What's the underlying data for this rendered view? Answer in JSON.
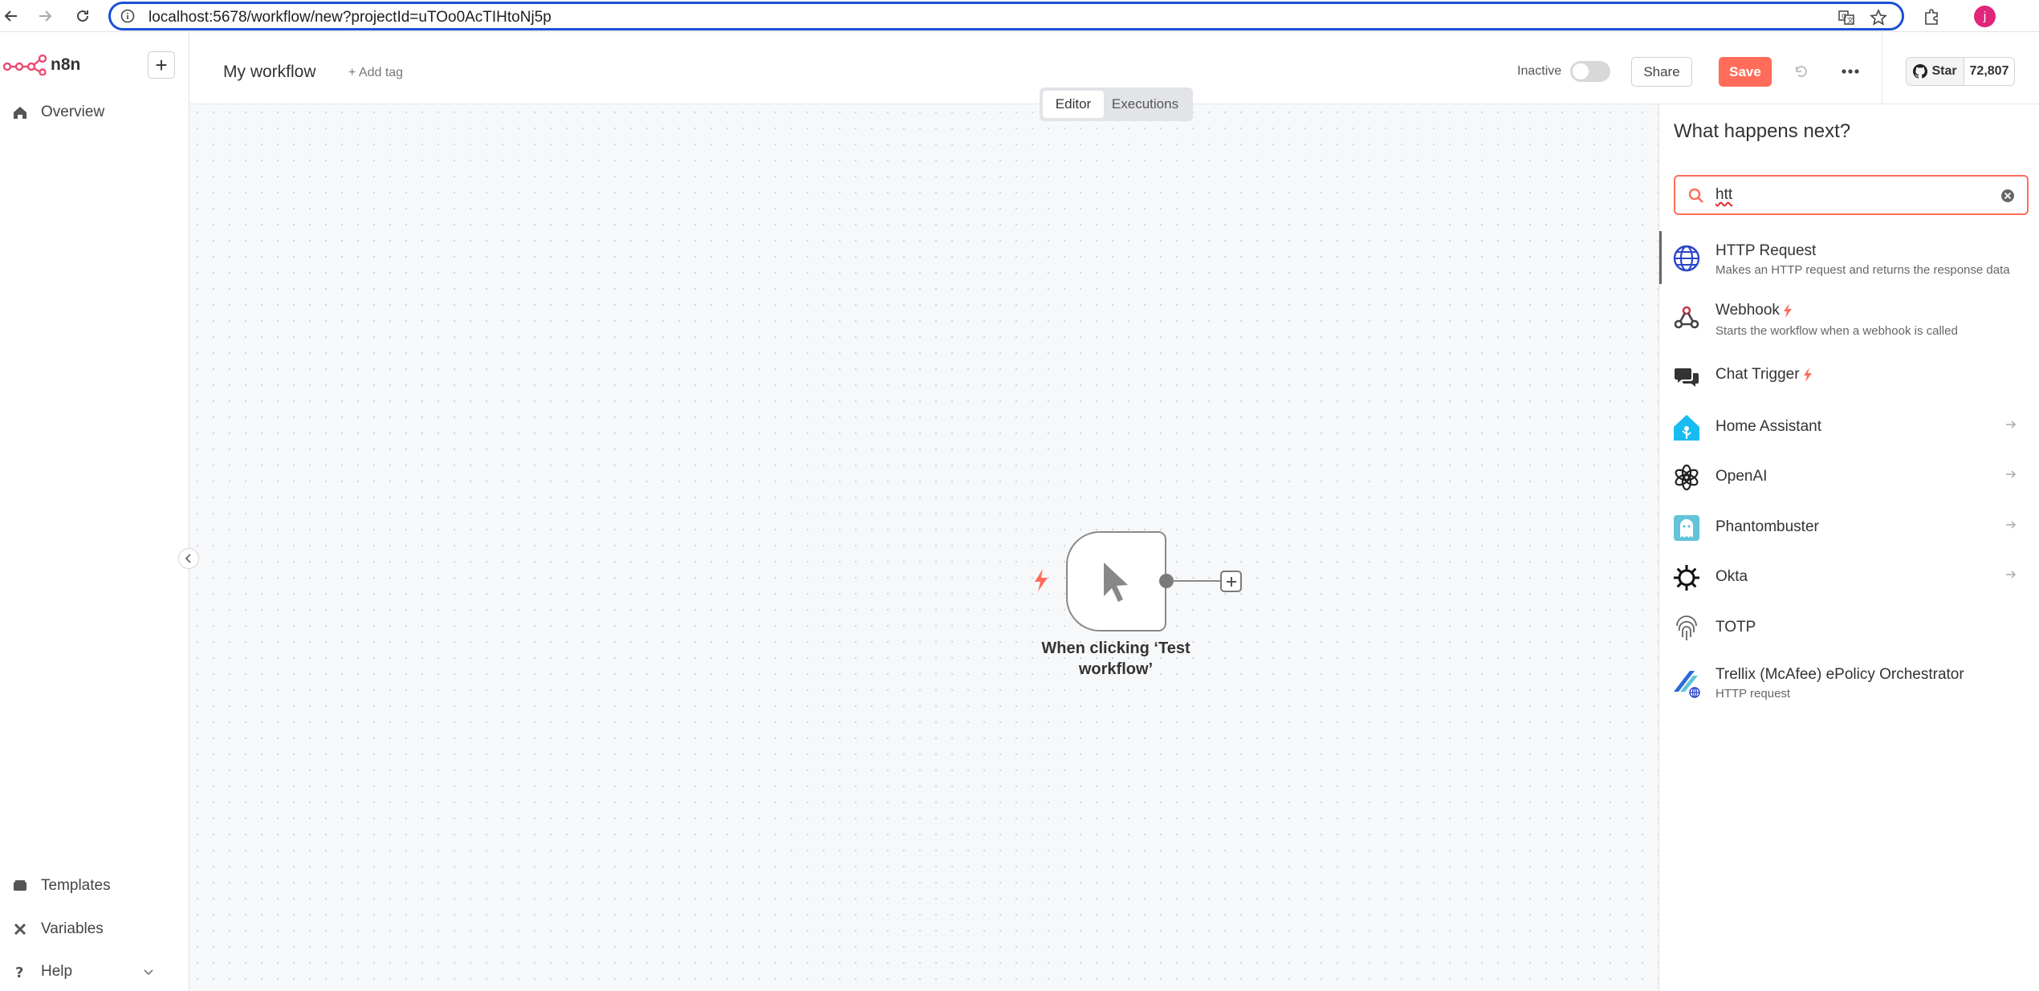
{
  "browser": {
    "url": "localhost:5678/workflow/new?projectId=uTOo0AcTIHtoNj5p",
    "profile_initial": "j"
  },
  "sidebar": {
    "brand": "n8n",
    "add_label": "+",
    "items": [
      {
        "label": "Overview",
        "icon": "home-icon"
      }
    ],
    "bottom_items": [
      {
        "label": "Templates",
        "icon": "templates-icon"
      },
      {
        "label": "Variables",
        "icon": "variables-icon"
      },
      {
        "label": "Help",
        "icon": "help-icon"
      }
    ]
  },
  "header": {
    "workflow_name": "My workflow",
    "add_tag": "+ Add tag",
    "status_label": "Inactive",
    "share_label": "Share",
    "save_label": "Save",
    "github_star_label": "Star",
    "github_star_count": "72,807"
  },
  "canvas": {
    "tabs": [
      {
        "label": "Editor",
        "active": true
      },
      {
        "label": "Executions",
        "active": false
      }
    ],
    "trigger_node": {
      "label": "When clicking ‘Test workflow’"
    }
  },
  "panel": {
    "title": "What happens next?",
    "search_value": "htt",
    "results": [
      {
        "name": "HTTP Request",
        "description": "Makes an HTTP request and returns the response data",
        "icon": "globe-icon",
        "trigger": false,
        "has_arrow": false
      },
      {
        "name": "Webhook",
        "description": "Starts the workflow when a webhook is called",
        "icon": "webhook-icon",
        "trigger": true,
        "has_arrow": false
      },
      {
        "name": "Chat Trigger",
        "description": "",
        "icon": "chat-icon",
        "trigger": true,
        "has_arrow": false
      },
      {
        "name": "Home Assistant",
        "description": "",
        "icon": "home-assistant-icon",
        "trigger": false,
        "has_arrow": true
      },
      {
        "name": "OpenAI",
        "description": "",
        "icon": "openai-icon",
        "trigger": false,
        "has_arrow": true
      },
      {
        "name": "Phantombuster",
        "description": "",
        "icon": "phantombuster-icon",
        "trigger": false,
        "has_arrow": true
      },
      {
        "name": "Okta",
        "description": "",
        "icon": "okta-icon",
        "trigger": false,
        "has_arrow": true
      },
      {
        "name": "TOTP",
        "description": "",
        "icon": "fingerprint-icon",
        "trigger": false,
        "has_arrow": false
      },
      {
        "name": "Trellix (McAfee) ePolicy Orchestrator",
        "description": "HTTP request",
        "icon": "trellix-icon",
        "trigger": false,
        "has_arrow": false
      }
    ]
  },
  "colors": {
    "accent": "#ff6d5a",
    "url_focus": "#1b4fd6"
  }
}
